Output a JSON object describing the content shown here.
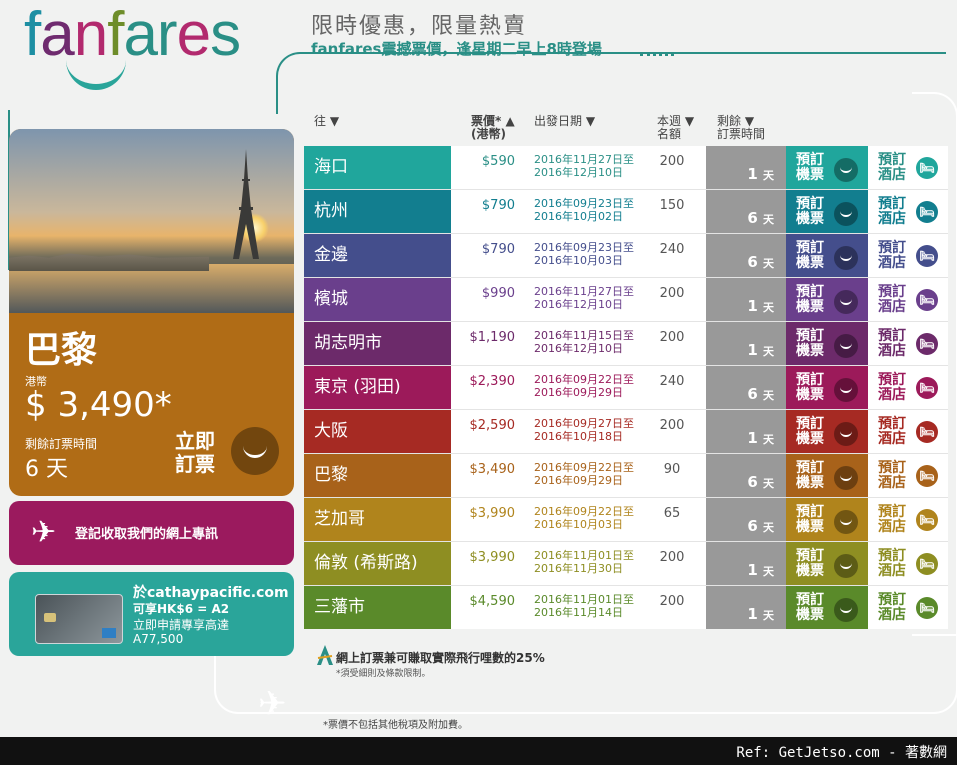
{
  "logo": {
    "letters": [
      "f",
      "a",
      "n",
      "f",
      "a",
      "r",
      "e",
      "s"
    ],
    "colors": [
      "#1d8fa3",
      "#6f2b6f",
      "#b22a6e",
      "#6e8d2a",
      "#2a8f86",
      "#2a8f86",
      "#b22a6e",
      "#2a8f86"
    ]
  },
  "header": {
    "headline": "限時優惠，限量熱賣",
    "subline": "fanfares震撼票價，逢星期二早上8時登場"
  },
  "columns": {
    "dest": "往 ▼",
    "price_l1": "票價* ▲",
    "price_l2": "(港幣)",
    "date": "出發日期 ▼",
    "quota_l1": "本週",
    "quota_l2": "名額",
    "quota_arrow": "▼",
    "remain_l1": "剩餘",
    "remain_l2": "訂票時間"
  },
  "book_label": "預訂機票",
  "hotel_label": "預訂酒店",
  "days_unit": "天",
  "rows": [
    {
      "dest": "海口",
      "price": "$590",
      "d1": "2016年11月27日至",
      "d2": "2016年12月10日",
      "quota": "200",
      "days": "1",
      "color": "#20a69c",
      "ink": "#2a8f86"
    },
    {
      "dest": "杭州",
      "price": "$790",
      "d1": "2016年09月23日至",
      "d2": "2016年10月02日",
      "quota": "150",
      "days": "6",
      "color": "#127e8f",
      "ink": "#127e8f"
    },
    {
      "dest": "金邊",
      "price": "$790",
      "d1": "2016年09月23日至",
      "d2": "2016年10月03日",
      "quota": "240",
      "days": "6",
      "color": "#444e8c",
      "ink": "#444e8c"
    },
    {
      "dest": "檳城",
      "price": "$990",
      "d1": "2016年11月27日至",
      "d2": "2016年12月10日",
      "quota": "200",
      "days": "1",
      "color": "#6a3f8c",
      "ink": "#6a3f8c"
    },
    {
      "dest": "胡志明市",
      "price": "$1,190",
      "d1": "2016年11月15日至",
      "d2": "2016年12月10日",
      "quota": "200",
      "days": "1",
      "color": "#6c2a6a",
      "ink": "#6c2a6a"
    },
    {
      "dest": "東京 (羽田)",
      "price": "$2,390",
      "d1": "2016年09月22日至",
      "d2": "2016年09月29日",
      "quota": "240",
      "days": "6",
      "color": "#9c1a5a",
      "ink": "#9c1a5a"
    },
    {
      "dest": "大阪",
      "price": "$2,590",
      "d1": "2016年09月27日至",
      "d2": "2016年10月18日",
      "quota": "200",
      "days": "1",
      "color": "#a62a23",
      "ink": "#a62a23"
    },
    {
      "dest": "巴黎",
      "price": "$3,490",
      "d1": "2016年09月22日至",
      "d2": "2016年09月29日",
      "quota": "90",
      "days": "6",
      "color": "#a8621a",
      "ink": "#a8621a"
    },
    {
      "dest": "芝加哥",
      "price": "$3,990",
      "d1": "2016年09月22日至",
      "d2": "2016年10月03日",
      "quota": "65",
      "days": "6",
      "color": "#b0841c",
      "ink": "#b0841c"
    },
    {
      "dest": "倫敦 (希斯路)",
      "price": "$3,990",
      "d1": "2016年11月01日至",
      "d2": "2016年11月30日",
      "quota": "200",
      "days": "1",
      "color": "#8e8e22",
      "ink": "#8e8e22"
    },
    {
      "dest": "三藩市",
      "price": "$4,590",
      "d1": "2016年11月01日至",
      "d2": "2016年11月14日",
      "quota": "200",
      "days": "1",
      "color": "#5a8a2a",
      "ink": "#5a8a2a"
    }
  ],
  "feature": {
    "city": "巴黎",
    "currency": "港幣",
    "price": "$ 3,490*",
    "remain_label": "剩餘訂票時間",
    "remain_value": "6 天",
    "cta": "立即訂票"
  },
  "signup": {
    "text": "登記收取我們的網上專訊"
  },
  "promo": {
    "l1": "於cathaypacific.com",
    "l2": "可享HK$6 = A2",
    "l3": "立即申請專享高達",
    "l4": "A77,500"
  },
  "miles_note": "網上訂票兼可賺取實際飛行哩數的25%",
  "terms": "*須受細則及條款限制。",
  "footnote": "*票價不包括其他稅項及附加費。",
  "ref": "Ref: GetJetso.com - 著數網"
}
